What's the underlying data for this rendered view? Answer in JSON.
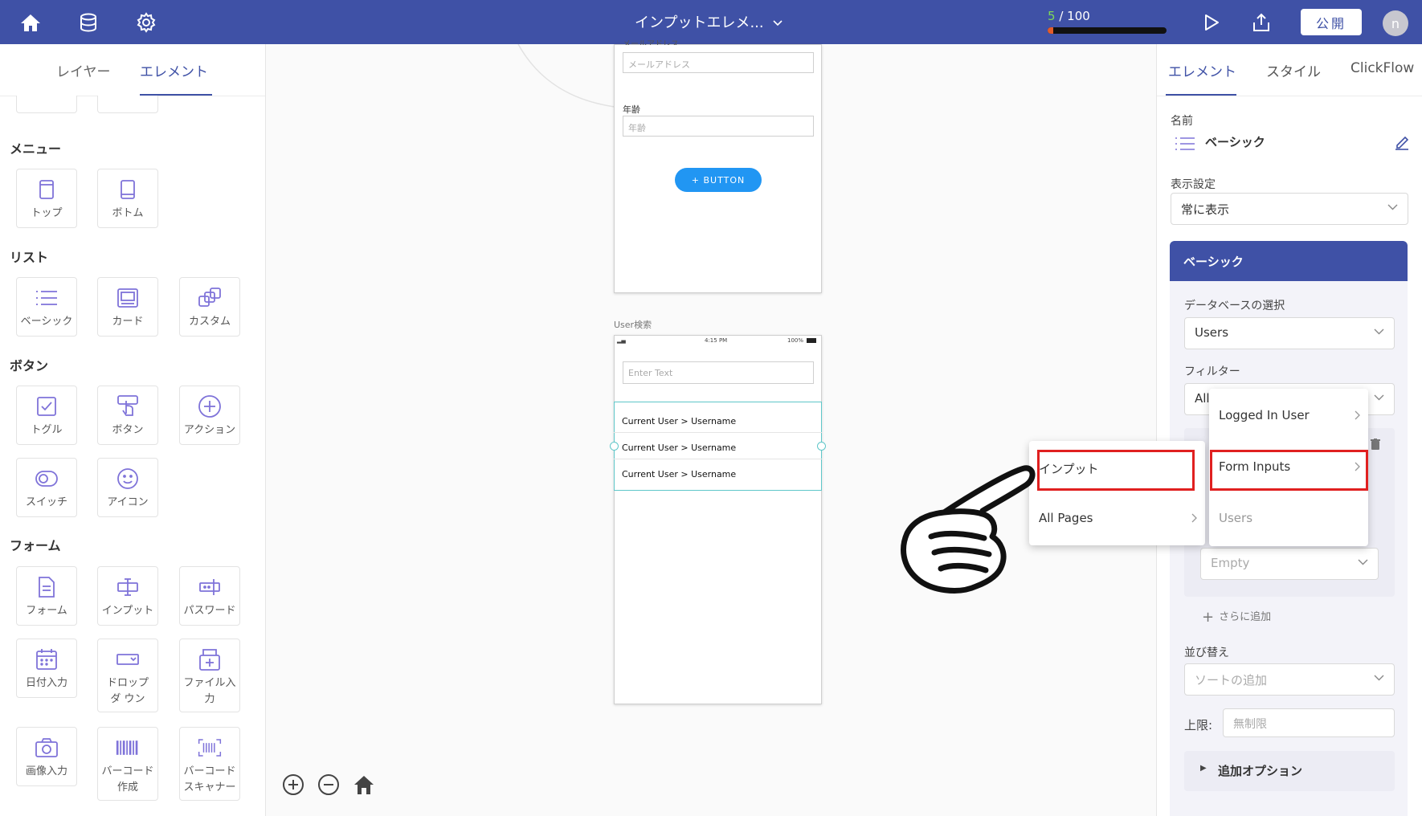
{
  "topbar": {
    "title": "インプットエレメ...",
    "progress_current": "5",
    "progress_total": "/ 100",
    "progress_fraction": 0.05,
    "publish_label": "公開",
    "avatar_initial": "n",
    "bar_color": "#3f51a6"
  },
  "left_panel": {
    "tabs": [
      "レイヤー",
      "エレメント"
    ],
    "active_tab": "エレメント",
    "categories": {
      "menu": "メニュー",
      "list": "リスト",
      "button": "ボタン",
      "form": "フォーム"
    },
    "tiles": {
      "top": "トップ",
      "bottom": "ボトム",
      "basic": "ベーシック",
      "card": "カード",
      "custom": "カスタム",
      "toggle": "トグル",
      "button": "ボタン",
      "action": "アクション",
      "switch": "スイッチ",
      "icon": "アイコン",
      "form": "フォーム",
      "input": "インプット",
      "password": "パスワード",
      "date_input": "日付入力",
      "dropdown": "ドロップダ ウン",
      "file_input": "ファイル入 力",
      "image_input": "画像入力",
      "barcode_create": "バーコード 作成",
      "barcode_scanner": "バーコード スキャナー"
    }
  },
  "canvas": {
    "screen1": {
      "email_label": "メールアドレス",
      "email_placeholder": "メールアドレス",
      "age_label": "年齢",
      "age_placeholder": "年齢",
      "button_label": "+ BUTTON"
    },
    "screen2": {
      "name": "User検索",
      "status_time": "4:15 PM",
      "status_battery": "100%",
      "search_placeholder": "Enter Text",
      "rows": [
        "Current User > Username",
        "Current User > Username",
        "Current User > Username"
      ]
    }
  },
  "right_panel": {
    "tabs": [
      "エレメント",
      "スタイル",
      "ClickFlow"
    ],
    "active_tab": "エレメント",
    "name_label": "名前",
    "name_value": "ベーシック",
    "visibility_label": "表示設定",
    "visibility_value": "常に表示",
    "section_title": "ベーシック",
    "db_label": "データベースの選択",
    "db_value": "Users",
    "filter_label": "フィルター",
    "filter_value": "All",
    "empty_placeholder": "Empty",
    "add_more": "さらに追加",
    "sort_label": "並び替え",
    "sort_placeholder": "ソートの追加",
    "limit_label": "上限:",
    "limit_placeholder": "無制限",
    "extra_options": "追加オプション"
  },
  "menus": {
    "menu1": [
      "インプット",
      "All Pages"
    ],
    "menu2": [
      "Logged In User",
      "Form Inputs",
      "Users"
    ]
  },
  "colors": {
    "accent": "#3f51a6",
    "highlight": "#e02020",
    "button_blue": "#2196f3"
  }
}
